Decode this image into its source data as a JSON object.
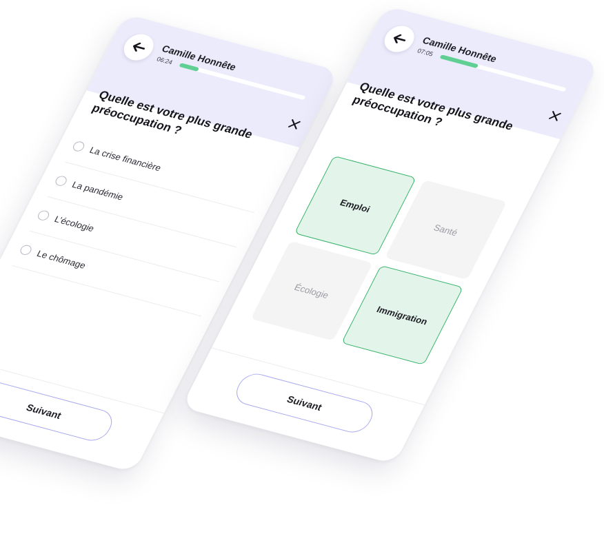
{
  "screens": [
    {
      "header": {
        "name": "Camille Honnête",
        "time": "06:24",
        "progress": 0.15
      },
      "question": "Quelle est votre plus grande préoccupation ?",
      "options": [
        {
          "label": "La crise financière",
          "selected": false
        },
        {
          "label": "La pandémie",
          "selected": false
        },
        {
          "label": "L’écologie",
          "selected": false
        },
        {
          "label": "Le chômage",
          "selected": false
        }
      ],
      "next_label": "Suivant"
    },
    {
      "header": {
        "name": "Camille Honnête",
        "time": "07:05",
        "progress": 0.3
      },
      "question": "Quelle est votre plus grande préoccupation ?",
      "tiles": [
        {
          "label": "Emploi",
          "selected": true
        },
        {
          "label": "Santé",
          "selected": false
        },
        {
          "label": "Écologie",
          "selected": false
        },
        {
          "label": "Immigration",
          "selected": true
        }
      ],
      "next_label": "Suivant"
    }
  ],
  "colors": {
    "header_bg": "#ebebfb",
    "progress_fill": "#5fcf93",
    "selected_tile_bg": "#e3f5ea",
    "selected_tile_border": "#36b369",
    "button_border": "#a9aaf0"
  },
  "icons": {
    "back": "arrow-left-icon",
    "close": "close-icon"
  }
}
